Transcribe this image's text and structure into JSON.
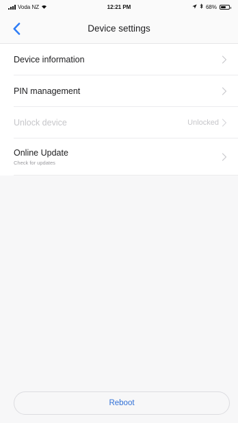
{
  "status_bar": {
    "carrier": "Voda NZ",
    "time": "12:21 PM",
    "battery": "68%",
    "battery_level": 0.68,
    "icons": [
      "signal-icon",
      "wifi-icon",
      "location-icon",
      "bluetooth-icon",
      "battery-icon"
    ]
  },
  "nav": {
    "title": "Device settings",
    "back_icon": "chevron-left-icon",
    "accent": "#2f7df6"
  },
  "list": {
    "device_information": {
      "label": "Device information"
    },
    "pin_management": {
      "label": "PIN management"
    },
    "unlock_device": {
      "label": "Unlock device",
      "value": "Unlocked"
    },
    "online_update": {
      "label": "Online Update",
      "subtitle": "Check for updates"
    }
  },
  "footer": {
    "reboot_label": "Reboot",
    "reboot_color": "#2f6fd6"
  }
}
